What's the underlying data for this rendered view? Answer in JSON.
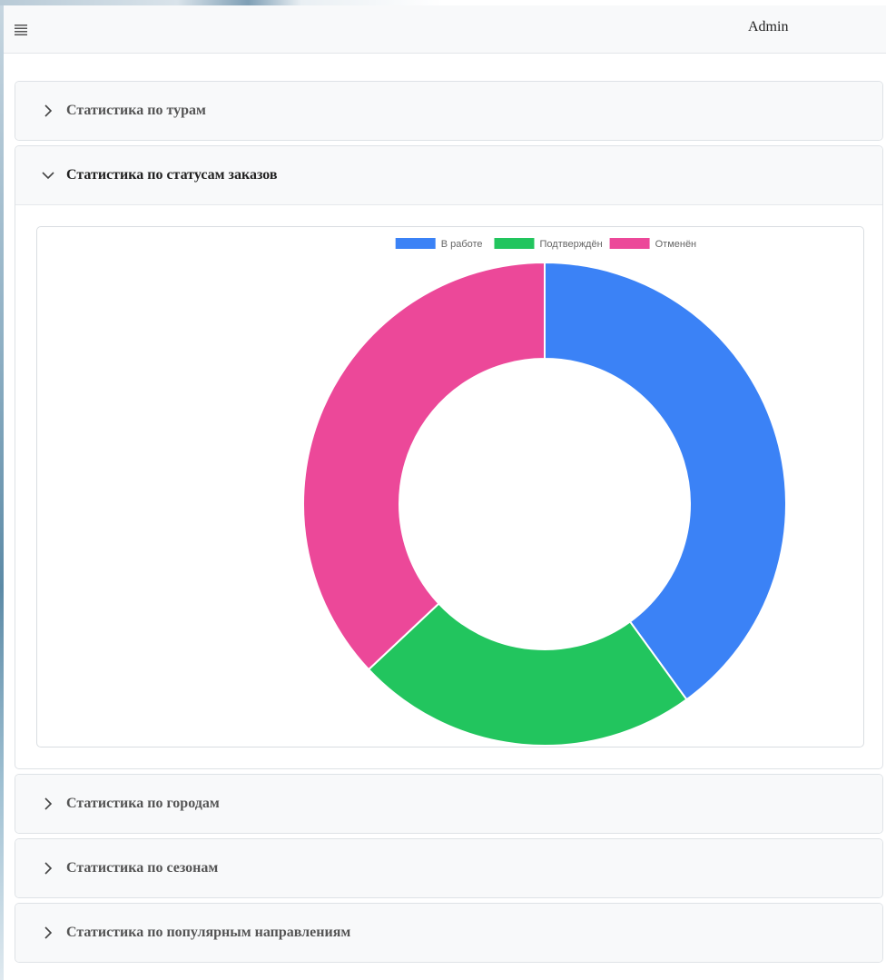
{
  "header": {
    "user": "Admin"
  },
  "sections": [
    {
      "title": "Статистика по турам",
      "expanded": false
    },
    {
      "title": "Статистика по статусам заказов",
      "expanded": true
    },
    {
      "title": "Статистика по городам",
      "expanded": false
    },
    {
      "title": "Статистика по сезонам",
      "expanded": false
    },
    {
      "title": "Статистика по популярным направлениям",
      "expanded": false
    }
  ],
  "icons": {
    "menu": "hamburger-icon",
    "collapsed": "chevron-right-icon",
    "expanded": "chevron-down-icon"
  },
  "chart_data": {
    "type": "pie",
    "style": "doughnut",
    "categories": [
      "В работе",
      "Подтверждён",
      "Отменён"
    ],
    "values": [
      40,
      23,
      37
    ],
    "colors": [
      "#3b82f6",
      "#22c55e",
      "#ec4899"
    ],
    "legend": "top"
  }
}
